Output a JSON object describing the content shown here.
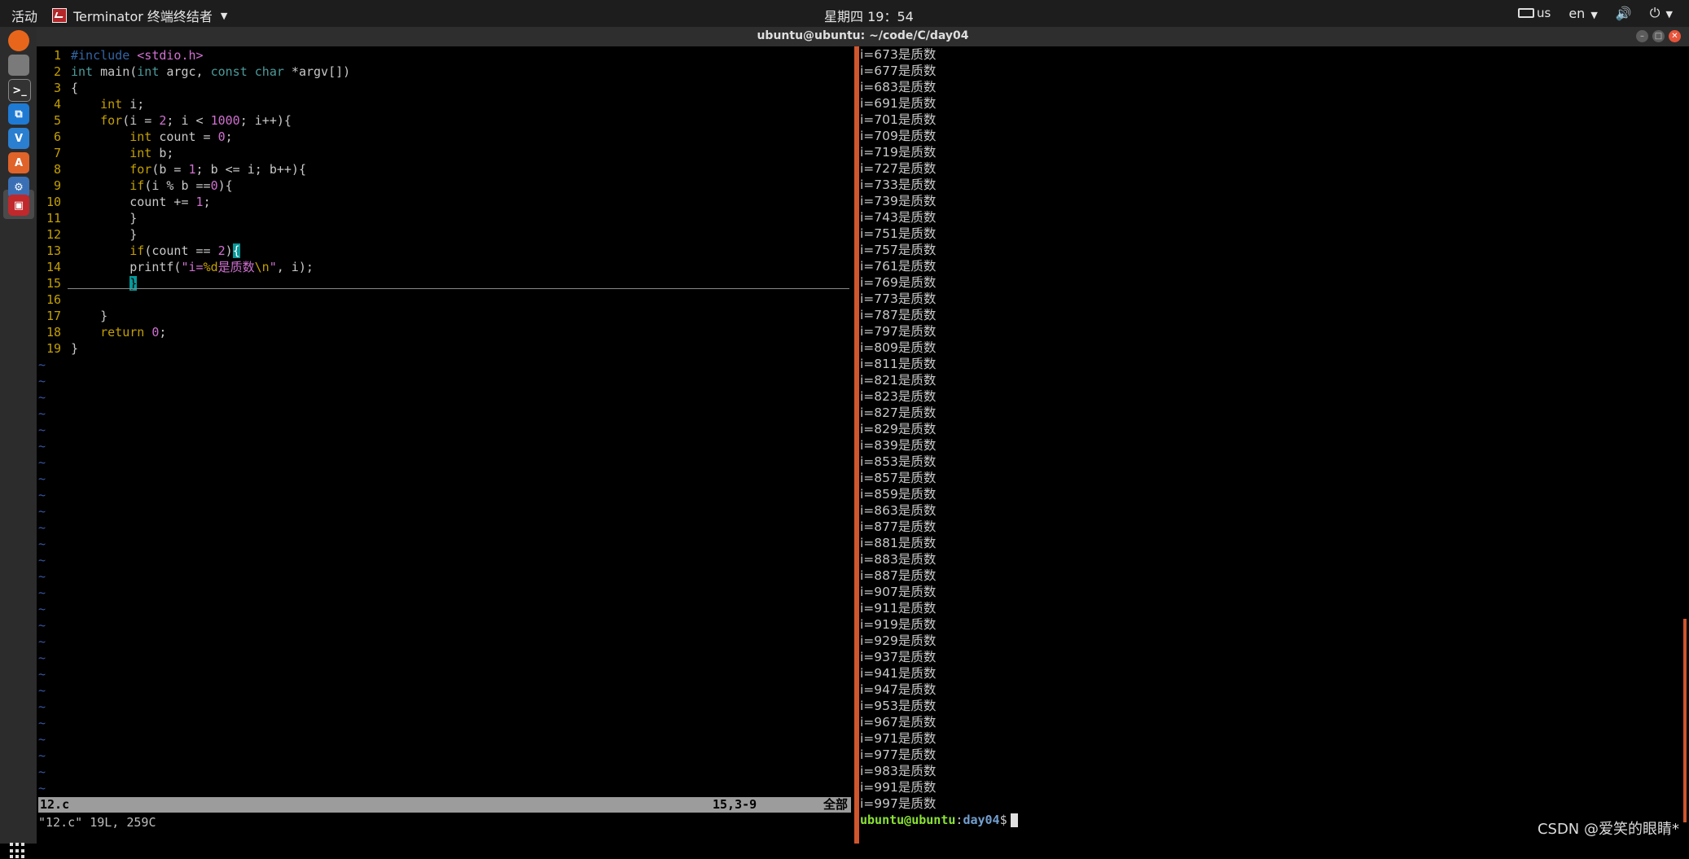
{
  "topbar": {
    "activities": "活动",
    "app_name": "Terminator 终端终结者",
    "clock": "星期四 19：54",
    "keyboard": "us",
    "language": "en"
  },
  "window": {
    "title": "ubuntu@ubuntu: ~/code/C/day04"
  },
  "dock": [
    {
      "name": "firefox-icon",
      "color": "#e8661b"
    },
    {
      "name": "files-icon",
      "color": "#7a7a7a"
    },
    {
      "name": "terminal-icon",
      "color": "#333333"
    },
    {
      "name": "vscode-icon",
      "color": "#1f7ad4"
    },
    {
      "name": "vc-icon",
      "color": "#2a7fd0"
    },
    {
      "name": "software-center-icon",
      "color": "#e0632a"
    },
    {
      "name": "settings-icon",
      "color": "#3a6fb5"
    },
    {
      "name": "terminator-icon",
      "color": "#c0282c"
    }
  ],
  "editor": {
    "lines": [
      {
        "n": "1",
        "segs": [
          [
            "pp",
            "#include "
          ],
          [
            "str",
            "<stdio.h>"
          ]
        ]
      },
      {
        "n": "2",
        "segs": [
          [
            "ty",
            "int"
          ],
          [
            "code",
            " main("
          ],
          [
            "ty",
            "int"
          ],
          [
            "code",
            " argc, "
          ],
          [
            "ty",
            "const char"
          ],
          [
            "code",
            " *argv[])"
          ]
        ]
      },
      {
        "n": "3",
        "segs": [
          [
            "code",
            "{"
          ]
        ]
      },
      {
        "n": "4",
        "segs": [
          [
            "code",
            "    "
          ],
          [
            "kw",
            "int"
          ],
          [
            "code",
            " i;"
          ]
        ]
      },
      {
        "n": "5",
        "segs": [
          [
            "code",
            "    "
          ],
          [
            "kw",
            "for"
          ],
          [
            "code",
            "(i = "
          ],
          [
            "num",
            "2"
          ],
          [
            "code",
            "; i < "
          ],
          [
            "num",
            "1000"
          ],
          [
            "code",
            "; i++){"
          ]
        ]
      },
      {
        "n": "6",
        "segs": [
          [
            "code",
            "        "
          ],
          [
            "kw",
            "int"
          ],
          [
            "code",
            " count = "
          ],
          [
            "num",
            "0"
          ],
          [
            "code",
            ";"
          ]
        ]
      },
      {
        "n": "7",
        "segs": [
          [
            "code",
            "        "
          ],
          [
            "kw",
            "int"
          ],
          [
            "code",
            " b;"
          ]
        ]
      },
      {
        "n": "8",
        "segs": [
          [
            "code",
            "        "
          ],
          [
            "kw",
            "for"
          ],
          [
            "code",
            "(b = "
          ],
          [
            "num",
            "1"
          ],
          [
            "code",
            "; b <= i; b++){"
          ]
        ]
      },
      {
        "n": "9",
        "segs": [
          [
            "code",
            "        "
          ],
          [
            "kw",
            "if"
          ],
          [
            "code",
            "(i % b =="
          ],
          [
            "num",
            "0"
          ],
          [
            "code",
            "){"
          ]
        ]
      },
      {
        "n": "10",
        "segs": [
          [
            "code",
            "        count += "
          ],
          [
            "num",
            "1"
          ],
          [
            "code",
            ";"
          ]
        ]
      },
      {
        "n": "11",
        "segs": [
          [
            "code",
            "        }"
          ]
        ]
      },
      {
        "n": "12",
        "segs": [
          [
            "code",
            "        }"
          ]
        ]
      },
      {
        "n": "13",
        "segs": [
          [
            "code",
            "        "
          ],
          [
            "kw",
            "if"
          ],
          [
            "code",
            "(count == "
          ],
          [
            "num",
            "2"
          ],
          [
            "code",
            ")"
          ],
          [
            "brace-hl",
            "{"
          ]
        ]
      },
      {
        "n": "14",
        "segs": [
          [
            "code",
            "        printf("
          ],
          [
            "str",
            "\"i="
          ],
          [
            "kw",
            "%d"
          ],
          [
            "str",
            "是质数"
          ],
          [
            "kw",
            "\\n"
          ],
          [
            "str",
            "\""
          ],
          [
            "code",
            ", i);"
          ]
        ]
      },
      {
        "n": "15",
        "segs": [
          [
            "code",
            "        "
          ],
          [
            "cursor-box",
            "}"
          ]
        ]
      },
      {
        "n": "16",
        "segs": [
          [
            "code",
            ""
          ]
        ]
      },
      {
        "n": "17",
        "segs": [
          [
            "code",
            "    }"
          ]
        ]
      },
      {
        "n": "18",
        "segs": [
          [
            "code",
            "    "
          ],
          [
            "kw",
            "return"
          ],
          [
            "code",
            " "
          ],
          [
            "num",
            "0"
          ],
          [
            "code",
            ";"
          ]
        ]
      },
      {
        "n": "19",
        "segs": [
          [
            "code",
            "}"
          ]
        ]
      }
    ],
    "tilde_count": 27,
    "status_file": "12.c",
    "status_pos": "15,3-9",
    "status_all": "全部",
    "cmdline": "\"12.c\" 19L, 259C"
  },
  "terminal": {
    "output": [
      "i=673是质数",
      "i=677是质数",
      "i=683是质数",
      "i=691是质数",
      "i=701是质数",
      "i=709是质数",
      "i=719是质数",
      "i=727是质数",
      "i=733是质数",
      "i=739是质数",
      "i=743是质数",
      "i=751是质数",
      "i=757是质数",
      "i=761是质数",
      "i=769是质数",
      "i=773是质数",
      "i=787是质数",
      "i=797是质数",
      "i=809是质数",
      "i=811是质数",
      "i=821是质数",
      "i=823是质数",
      "i=827是质数",
      "i=829是质数",
      "i=839是质数",
      "i=853是质数",
      "i=857是质数",
      "i=859是质数",
      "i=863是质数",
      "i=877是质数",
      "i=881是质数",
      "i=883是质数",
      "i=887是质数",
      "i=907是质数",
      "i=911是质数",
      "i=919是质数",
      "i=929是质数",
      "i=937是质数",
      "i=941是质数",
      "i=947是质数",
      "i=953是质数",
      "i=967是质数",
      "i=971是质数",
      "i=977是质数",
      "i=983是质数",
      "i=991是质数",
      "i=997是质数"
    ],
    "prompt_user": "ubuntu@ubuntu",
    "prompt_colon": ":",
    "prompt_path": "day04",
    "prompt_dollar": "$"
  },
  "watermark": "CSDN @爱笑的眼睛*"
}
